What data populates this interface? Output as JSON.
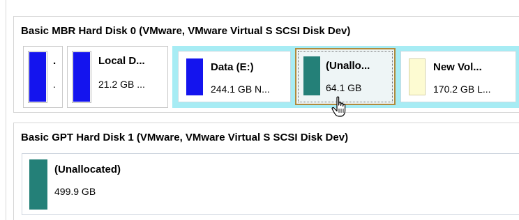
{
  "colors": {
    "primary_bar": "#1414ee",
    "unallocated_bar": "#248078",
    "logical_bar": "#fdfbd2",
    "extended_bg": "#a7ecf4",
    "selection_border": "#b08a3c"
  },
  "disk0": {
    "title": "Basic MBR Hard Disk 0 (VMware, VMware Virtual S SCSI Disk Dev)",
    "partitions": [
      {
        "name": ".",
        "info": "."
      },
      {
        "name": "Local D...",
        "info": "21.2 GB ..."
      },
      {
        "name": "Data (E:)",
        "info": "244.1 GB N..."
      },
      {
        "name": "(Unallo...",
        "info": "64.1 GB"
      },
      {
        "name": "New Vol...",
        "info": "170.2 GB L..."
      }
    ]
  },
  "disk1": {
    "title": "Basic GPT Hard Disk 1 (VMware, VMware Virtual S SCSI Disk Dev)",
    "partitions": [
      {
        "name": "(Unallocated)",
        "info": "499.9 GB"
      }
    ]
  },
  "cursor_icon": "hand-pointer-icon"
}
